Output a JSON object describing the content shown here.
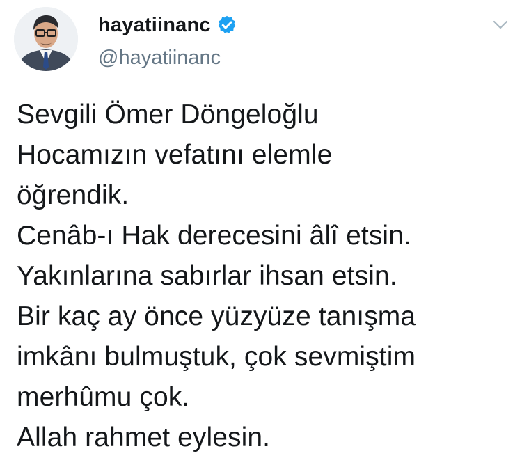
{
  "author": {
    "display_name": "hayatiinanc",
    "handle": "@hayatiinanc",
    "verified_icon": "verified-badge-icon",
    "verified_color": "#1da1f2",
    "avatar": "avatar-photo"
  },
  "header": {
    "menu_icon": "chevron-down-icon",
    "menu_icon_color": "#aab8c2"
  },
  "tweet": {
    "lines": [
      "Sevgili Ömer Döngeloğlu",
      "Hocamızın vefatını elemle",
      "öğrendik.",
      "Cenâb-ı Hak derecesini âlî etsin.",
      "Yakınlarına sabırlar ihsan etsin.",
      "Bir kaç ay önce yüzyüze tanışma",
      "imkânı bulmuştuk, çok sevmiştim",
      "merhûmu çok.",
      "Allah rahmet eylesin."
    ]
  },
  "colors": {
    "text_primary": "#14171a",
    "text_secondary": "#657786",
    "background": "#ffffff"
  }
}
